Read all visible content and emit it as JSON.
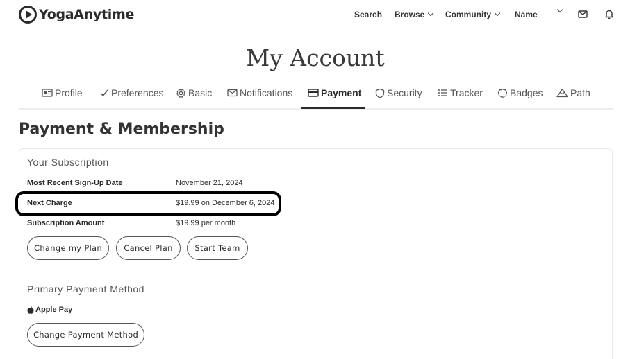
{
  "header": {
    "logo_text": "YogaAnytime",
    "nav": {
      "search": "Search",
      "browse": "Browse",
      "community": "Community"
    },
    "account_name": "Name",
    "icons": [
      "mail-icon",
      "bell-icon"
    ]
  },
  "page": {
    "title": "My Account"
  },
  "tabs": [
    {
      "label": "Profile",
      "icon": "id-card-icon",
      "active": false
    },
    {
      "label": "Preferences",
      "icon": "check-icon",
      "active": false
    },
    {
      "label": "Basic",
      "icon": "gear-icon",
      "active": false
    },
    {
      "label": "Notifications",
      "icon": "envelope-icon",
      "active": false
    },
    {
      "label": "Payment",
      "icon": "credit-card-icon",
      "active": true
    },
    {
      "label": "Security",
      "icon": "shield-icon",
      "active": false
    },
    {
      "label": "Tracker",
      "icon": "list-icon",
      "active": false
    },
    {
      "label": "Badges",
      "icon": "badge-icon",
      "active": false
    },
    {
      "label": "Path",
      "icon": "mountain-icon",
      "active": false
    }
  ],
  "payment": {
    "section_title": "Payment & Membership",
    "subscription": {
      "heading": "Your Subscription",
      "rows": [
        {
          "label": "Most Recent Sign-Up Date",
          "value": "November 21, 2024"
        },
        {
          "label": "Next Charge",
          "value": "$19.99 on December 6, 2024"
        },
        {
          "label": "Subscription Amount",
          "value": "$19.99 per month"
        }
      ],
      "buttons": {
        "change_plan": "Change my Plan",
        "cancel_plan": "Cancel Plan",
        "start_team": "Start Team"
      }
    },
    "primary_method": {
      "heading": "Primary Payment Method",
      "method": "Apple Pay",
      "change_button": "Change Payment Method"
    }
  },
  "colors": {
    "text": "#2b2b2b",
    "border": "#e8e8e8",
    "highlight": "#000000"
  }
}
